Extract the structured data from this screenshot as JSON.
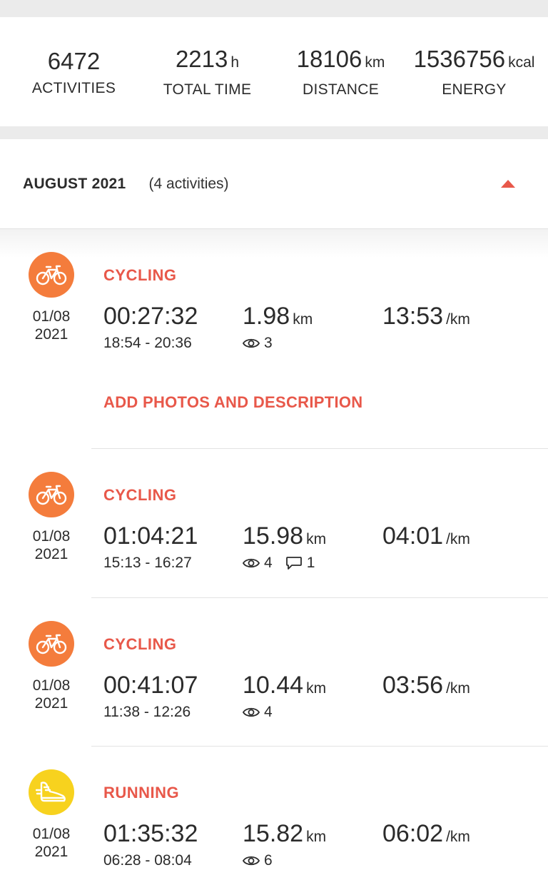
{
  "summary": {
    "activities": {
      "value": "6472",
      "unit": "",
      "label": "ACTIVITIES"
    },
    "total_time": {
      "value": "2213",
      "unit": "h",
      "label": "TOTAL TIME"
    },
    "distance": {
      "value": "18106",
      "unit": "km",
      "label": "DISTANCE"
    },
    "energy": {
      "value": "1536756",
      "unit": "kcal",
      "label": "ENERGY"
    }
  },
  "month": {
    "title": "AUGUST 2021",
    "count": "(4 activities)"
  },
  "activities": [
    {
      "type": "CYCLING",
      "icon": "bicycle-icon",
      "icon_bg": "#f47c3c",
      "date_line1": "01/08",
      "date_line2": "2021",
      "duration": "00:27:32",
      "time_range": "18:54 - 20:36",
      "distance": "1.98",
      "distance_unit": "km",
      "pace": "13:53",
      "pace_unit": "/km",
      "views": "3",
      "comments": "",
      "add_label": "ADD PHOTOS AND DESCRIPTION"
    },
    {
      "type": "CYCLING",
      "icon": "bicycle-icon",
      "icon_bg": "#f47c3c",
      "date_line1": "01/08",
      "date_line2": "2021",
      "duration": "01:04:21",
      "time_range": "15:13 - 16:27",
      "distance": "15.98",
      "distance_unit": "km",
      "pace": "04:01",
      "pace_unit": "/km",
      "views": "4",
      "comments": "1"
    },
    {
      "type": "CYCLING",
      "icon": "bicycle-icon",
      "icon_bg": "#f47c3c",
      "date_line1": "01/08",
      "date_line2": "2021",
      "duration": "00:41:07",
      "time_range": "11:38 - 12:26",
      "distance": "10.44",
      "distance_unit": "km",
      "pace": "03:56",
      "pace_unit": "/km",
      "views": "4",
      "comments": ""
    },
    {
      "type": "RUNNING",
      "icon": "running-shoe-icon",
      "icon_bg": "#f7d21e",
      "date_line1": "01/08",
      "date_line2": "2021",
      "duration": "01:35:32",
      "time_range": "06:28 - 08:04",
      "distance": "15.82",
      "distance_unit": "km",
      "pace": "06:02",
      "pace_unit": "/km",
      "views": "6",
      "comments": ""
    }
  ],
  "colors": {
    "accent": "#e8584a",
    "cycling": "#f47c3c",
    "running": "#f7d21e"
  }
}
